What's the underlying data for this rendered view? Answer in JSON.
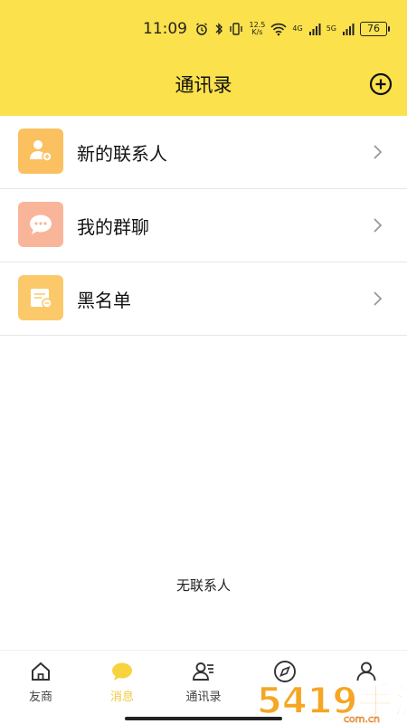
{
  "status": {
    "time": "11:09",
    "net_speed_top": "12.5",
    "net_speed_bottom": "K/s",
    "sig_a": "4G",
    "sig_b": "5G",
    "battery": "76"
  },
  "header": {
    "title": "通讯录"
  },
  "list": [
    {
      "label": "新的联系人",
      "icon": "add-contact-icon",
      "color": "#fbc05f"
    },
    {
      "label": "我的群聊",
      "icon": "chat-bubble-icon",
      "color": "#f9b59a"
    },
    {
      "label": "黑名单",
      "icon": "blocklist-icon",
      "color": "#fbc96a"
    }
  ],
  "empty_text": "无联系人",
  "nav": [
    {
      "label": "友商",
      "icon": "home-icon"
    },
    {
      "label": "消息",
      "icon": "message-icon"
    },
    {
      "label": "通讯录",
      "icon": "contacts-icon"
    },
    {
      "label": "",
      "icon": "compass-icon"
    },
    {
      "label": "",
      "icon": "profile-icon"
    }
  ],
  "watermark": {
    "text": "5419手游网",
    "sub": "com.cn"
  },
  "colors": {
    "header_bg": "#fbe14b",
    "accent": "#f2c93a"
  }
}
